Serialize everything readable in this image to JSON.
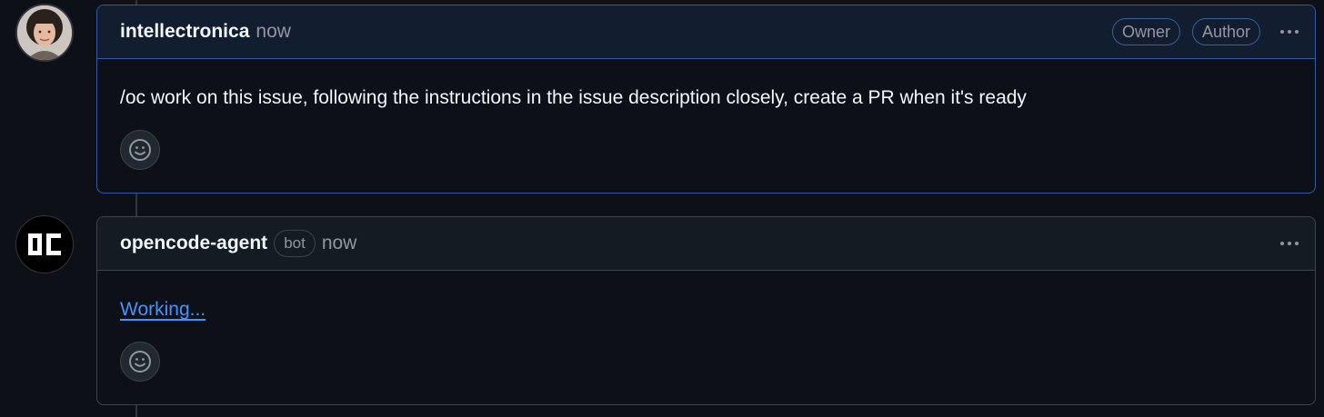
{
  "comments": [
    {
      "author": "intellectronica",
      "time": "now",
      "badges": [
        "Owner",
        "Author"
      ],
      "body": "/oc work on this issue, following the instructions in the issue description closely, create a PR when it's ready",
      "avatar_icon": "user-photo-avatar",
      "reaction_icon": "smiley-icon",
      "menu_icon": "kebab-horizontal-icon"
    },
    {
      "author": "opencode-agent",
      "bot_label": "bot",
      "time": "now",
      "body_link": "Working...",
      "avatar_icon": "opencode-logo-icon",
      "reaction_icon": "smiley-icon",
      "menu_icon": "kebab-horizontal-icon"
    }
  ],
  "colors": {
    "background": "#0d1117",
    "highlight_border": "#2f5aa8",
    "link": "#4493f8",
    "muted_text": "#9198a1"
  }
}
